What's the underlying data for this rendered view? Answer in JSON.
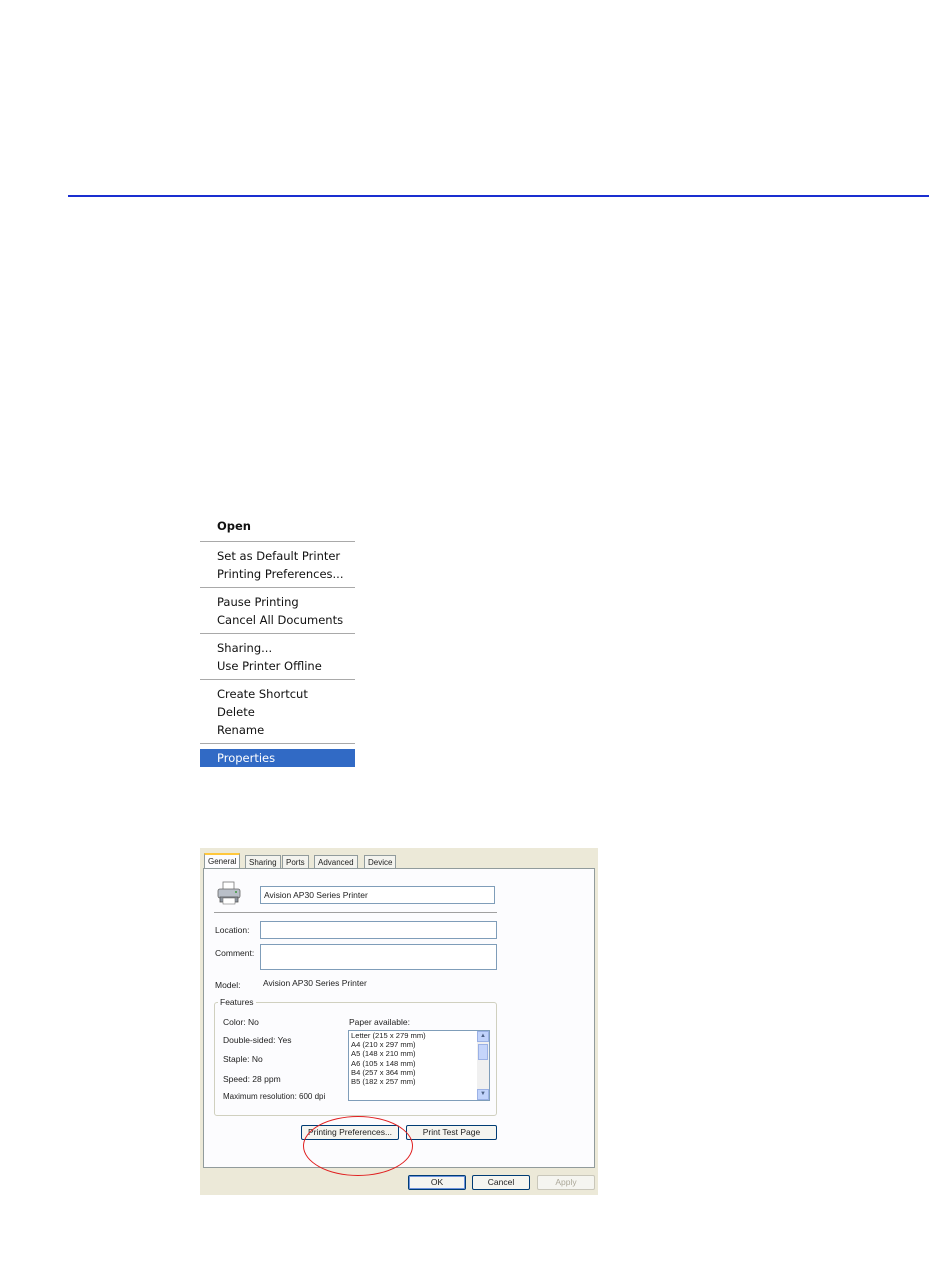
{
  "context_menu": {
    "items": [
      {
        "label": "Open"
      },
      {
        "label": "Set as Default Printer"
      },
      {
        "label": "Printing Preferences..."
      },
      {
        "label": "Pause Printing"
      },
      {
        "label": "Cancel All Documents"
      },
      {
        "label": "Sharing..."
      },
      {
        "label": "Use Printer Offline"
      },
      {
        "label": "Create Shortcut"
      },
      {
        "label": "Delete"
      },
      {
        "label": "Rename"
      },
      {
        "label": "Properties"
      }
    ],
    "selected": "Properties",
    "selected_color": "#316ac5"
  },
  "dialog": {
    "tabs": [
      "General",
      "Sharing",
      "Ports",
      "Advanced",
      "Device"
    ],
    "active_tab": "General",
    "printer_name": "Avision AP30 Series Printer",
    "location_label": "Location:",
    "location_value": "",
    "comment_label": "Comment:",
    "comment_value": "",
    "model_label": "Model:",
    "model_value": "Avision AP30 Series Printer",
    "features": {
      "title": "Features",
      "color": "Color: No",
      "double_sided": "Double-sided: Yes",
      "staple": "Staple: No",
      "speed": "Speed: 28 ppm",
      "max_resolution": "Maximum resolution: 600 dpi",
      "paper_label": "Paper available:",
      "paper_list": [
        "Letter (215 x 279 mm)",
        "A4 (210 x 297 mm)",
        "A5 (148 x 210 mm)",
        "A6 (105 x 148 mm)",
        "B4 (257 x 364 mm)",
        "B5 (182 x 257 mm)"
      ]
    },
    "buttons": {
      "printing_preferences": "Printing Preferences...",
      "print_test_page": "Print Test Page",
      "ok": "OK",
      "cancel": "Cancel",
      "apply": "Apply"
    }
  },
  "colors": {
    "rule": "#1a2fd0",
    "annotation_circle": "#e02020"
  }
}
